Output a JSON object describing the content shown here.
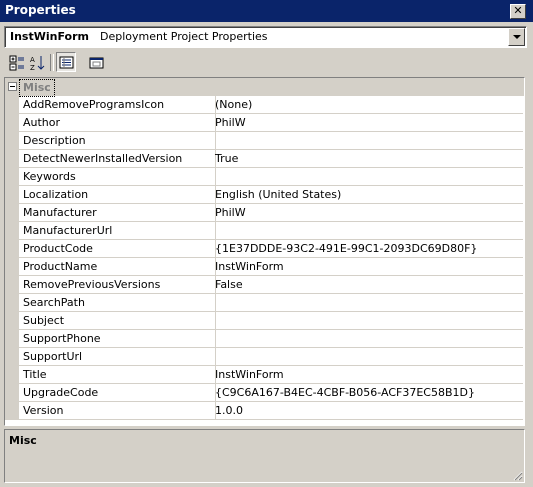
{
  "window": {
    "title": "Properties",
    "close_glyph": "✕"
  },
  "object_selector": {
    "name": "InstWinForm",
    "type": "Deployment Project Properties"
  },
  "toolbar": {
    "buttons": [
      {
        "icon": "categorized-icon",
        "pressed": false
      },
      {
        "icon": "alphabetical-icon",
        "pressed": false
      },
      {
        "icon": "properties-icon",
        "pressed": true
      },
      {
        "icon": "property-pages-icon",
        "pressed": false
      }
    ]
  },
  "grid": {
    "category": "Misc",
    "properties": [
      {
        "name": "AddRemoveProgramsIcon",
        "value": "(None)"
      },
      {
        "name": "Author",
        "value": "PhilW"
      },
      {
        "name": "Description",
        "value": ""
      },
      {
        "name": "DetectNewerInstalledVersion",
        "value": "True"
      },
      {
        "name": "Keywords",
        "value": ""
      },
      {
        "name": "Localization",
        "value": "English (United States)"
      },
      {
        "name": "Manufacturer",
        "value": "PhilW"
      },
      {
        "name": "ManufacturerUrl",
        "value": ""
      },
      {
        "name": "ProductCode",
        "value": "{1E37DDDE-93C2-491E-99C1-2093DC69D80F}"
      },
      {
        "name": "ProductName",
        "value": "InstWinForm"
      },
      {
        "name": "RemovePreviousVersions",
        "value": "False"
      },
      {
        "name": "SearchPath",
        "value": ""
      },
      {
        "name": "Subject",
        "value": ""
      },
      {
        "name": "SupportPhone",
        "value": ""
      },
      {
        "name": "SupportUrl",
        "value": ""
      },
      {
        "name": "Title",
        "value": "InstWinForm"
      },
      {
        "name": "UpgradeCode",
        "value": "{C9C6A167-B4EC-4CBF-B056-ACF37EC58B1D}"
      },
      {
        "name": "Version",
        "value": "1.0.0"
      }
    ]
  },
  "description_pane": {
    "title": "Misc",
    "text": ""
  },
  "colors": {
    "titlebar": "#0a246a",
    "face": "#d4d0c8",
    "gridline": "#d4d0c8"
  }
}
